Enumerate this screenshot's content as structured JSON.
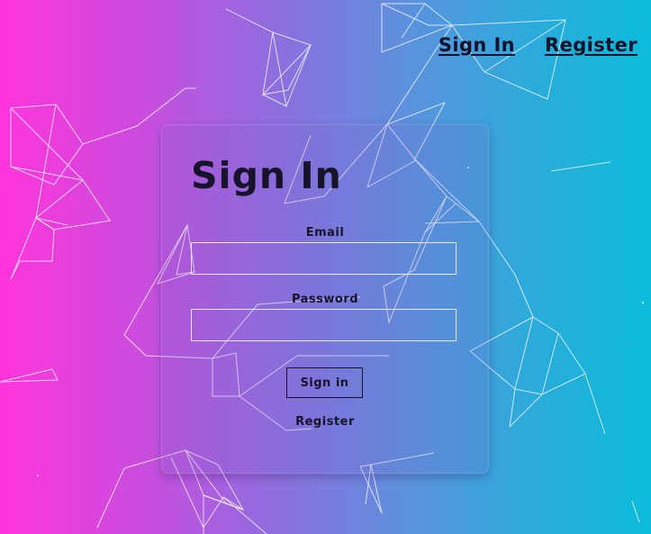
{
  "nav": {
    "sign_in_label": "Sign In",
    "register_label": "Register"
  },
  "form": {
    "title": "Sign In",
    "email_label": "Email",
    "email_value": "",
    "password_label": "Password",
    "password_value": "",
    "submit_label": "Sign in",
    "register_link": "Register"
  },
  "colors": {
    "gradient_left": "#ff35dc",
    "gradient_right": "#0bbbd9",
    "text_dark": "#17132a",
    "network_lines": "#ffffff"
  }
}
